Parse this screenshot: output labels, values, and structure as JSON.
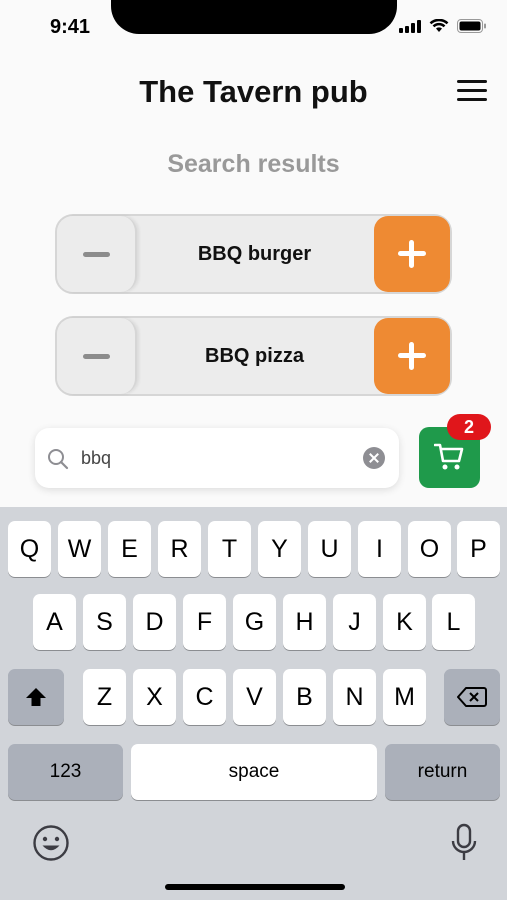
{
  "status_bar": {
    "time": "9:41"
  },
  "header": {
    "title": "The Tavern pub"
  },
  "section_title": "Search results",
  "results": [
    {
      "label": "BBQ burger"
    },
    {
      "label": "BBQ pizza"
    }
  ],
  "search": {
    "value": "bbq"
  },
  "cart": {
    "count": "2"
  },
  "keyboard": {
    "row1": [
      "Q",
      "W",
      "E",
      "R",
      "T",
      "Y",
      "U",
      "I",
      "O",
      "P"
    ],
    "row2": [
      "A",
      "S",
      "D",
      "F",
      "G",
      "H",
      "J",
      "K",
      "L"
    ],
    "row3": [
      "Z",
      "X",
      "C",
      "V",
      "B",
      "N",
      "M"
    ],
    "numbers_label": "123",
    "space_label": "space",
    "return_label": "return"
  },
  "colors": {
    "accent_orange": "#ee8a33",
    "cart_green": "#1f9a4b",
    "badge_red": "#e0161b"
  }
}
